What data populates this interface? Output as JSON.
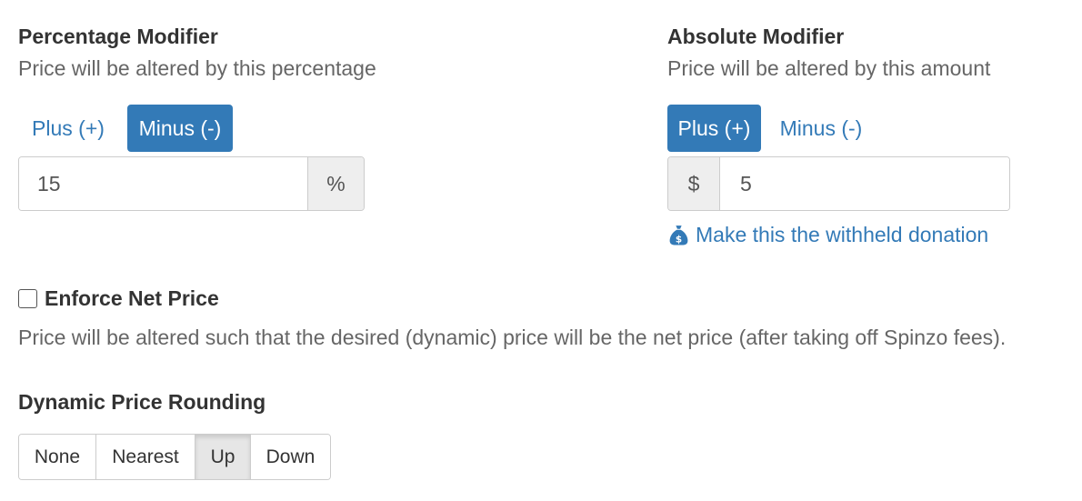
{
  "percentage_modifier": {
    "heading": "Percentage Modifier",
    "subtext": "Price will be altered by this percentage",
    "plus_label": "Plus (+)",
    "minus_label": "Minus (-)",
    "selected": "minus",
    "value": "15",
    "addon": "%"
  },
  "absolute_modifier": {
    "heading": "Absolute Modifier",
    "subtext": "Price will be altered by this amount",
    "plus_label": "Plus (+)",
    "minus_label": "Minus (-)",
    "selected": "plus",
    "addon": "$",
    "value": "5",
    "donation_link": "Make this the withheld donation",
    "donation_icon": "money-bag-icon"
  },
  "enforce_net_price": {
    "label": "Enforce Net Price",
    "checked": false,
    "description": "Price will be altered such that the desired (dynamic) price will be the net price (after taking off Spinzo fees)."
  },
  "rounding": {
    "heading": "Dynamic Price Rounding",
    "options": [
      "None",
      "Nearest",
      "Up",
      "Down"
    ],
    "selected": "Up"
  },
  "colors": {
    "accent": "#337ab7",
    "active_segment": "#e6e6e6",
    "border": "#cccccc"
  }
}
